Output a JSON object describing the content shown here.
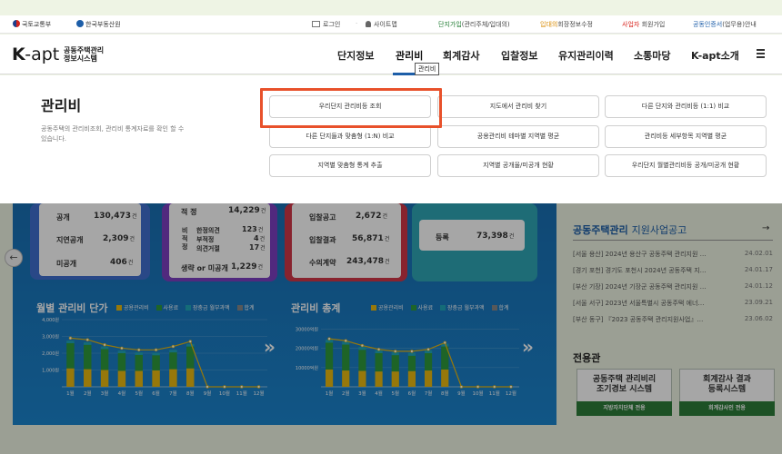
{
  "util": {
    "gov": "국토교통부",
    "reb": "한국부동산원",
    "login": "로그인",
    "sitemap": "사이트맵",
    "join_main": "단지가입",
    "join_sub": "(관리주체/입대의)",
    "resident_main": "입대의",
    "resident_sub": "회장정보수정",
    "biz_main": "사업자",
    "biz_sub": "회원가입",
    "cert_main": "공동인증서",
    "cert_sub": "(업무용)안내"
  },
  "logo": {
    "k": "K",
    "apt": "-apt",
    "line1": "공동주택관리",
    "line2": "정보시스템"
  },
  "menu": [
    "단지정보",
    "관리비",
    "회계감사",
    "입찰정보",
    "유지관리이력",
    "소통마당",
    "K-apt소개"
  ],
  "tooltip": "관리비",
  "panel": {
    "title": "관리비",
    "desc": "공동주택의 관리비조회, 관리비 통계자료를 확인 할 수 있습니다.",
    "buttons": [
      "우리단지 관리비등 조회",
      "지도에서 관리비 찾기",
      "다른 단지와 관리비등 (1:1) 비교",
      "다른 단지들과 맞춤형 (1:N) 비교",
      "공용관리비 테마별 지역별 평균",
      "관리비등 세부항목 지역별 평균",
      "지역별 맞춤형 통계 추출",
      "지역별 공개율/미공개 현황",
      "우리단지 월별관리비등 공개/미공개 현황"
    ]
  },
  "stats": {
    "c1": [
      {
        "label": "공개",
        "value": "130,473",
        "unit": "건"
      },
      {
        "label": "지연공개",
        "value": "2,309",
        "unit": "건"
      },
      {
        "label": "미공개",
        "value": "406",
        "unit": "건"
      }
    ],
    "c2": {
      "top_label": "적 정",
      "top_value": "14,229",
      "top_unit": "건",
      "side": "비\n적\n정",
      "rows": [
        {
          "label": "한정의견",
          "value": "123",
          "unit": "건"
        },
        {
          "label": "부적정",
          "value": "4",
          "unit": "건"
        },
        {
          "label": "의견거절",
          "value": "17",
          "unit": "건"
        }
      ],
      "bottom_label": "생략 or 미공개",
      "bottom_value": "1,229",
      "bottom_unit": "건"
    },
    "c3": [
      {
        "label": "입찰공고",
        "value": "2,672",
        "unit": "건"
      },
      {
        "label": "입찰결과",
        "value": "56,871",
        "unit": "건"
      },
      {
        "label": "수의계약",
        "value": "243,478",
        "unit": "건"
      }
    ],
    "c4": {
      "label": "등록",
      "value": "73,398",
      "unit": "건"
    }
  },
  "charts": {
    "monthly_title": "월별 관리비 단가",
    "total_title": "관리비 총계",
    "legend": [
      "공용관리비",
      "사용료",
      "장충금 월부과액",
      "합계"
    ],
    "legend_colors": [
      "#e8b810",
      "#2f9a3c",
      "#1fa7b8",
      "#888888"
    ],
    "monthly_yticks": [
      "4,000원",
      "3,000원",
      "2,000원",
      "1,000원"
    ],
    "total_yticks": [
      "30000억원",
      "20000억원",
      "10000억원"
    ],
    "months": [
      "1월",
      "2월",
      "3월",
      "4월",
      "5월",
      "6월",
      "7월",
      "8월",
      "9월",
      "10월",
      "11월",
      "12월"
    ]
  },
  "chart_data": [
    {
      "type": "bar",
      "title": "월별 관리비 단가",
      "categories": [
        "1월",
        "2월",
        "3월",
        "4월",
        "5월",
        "6월",
        "7월",
        "8월",
        "9월",
        "10월",
        "11월",
        "12월"
      ],
      "ylim": [
        0,
        4000
      ],
      "series": [
        {
          "name": "공용관리비",
          "values": [
            1100,
            1050,
            1000,
            950,
            950,
            980,
            1050,
            1100,
            0,
            0,
            0,
            0
          ]
        },
        {
          "name": "사용료",
          "values": [
            1500,
            1450,
            1250,
            1050,
            950,
            900,
            1000,
            1300,
            0,
            0,
            0,
            0
          ]
        },
        {
          "name": "장충금 월부과액",
          "values": [
            150,
            150,
            150,
            150,
            150,
            150,
            150,
            150,
            0,
            0,
            0,
            0
          ]
        },
        {
          "name": "합계",
          "values": [
            2900,
            2800,
            2500,
            2300,
            2200,
            2200,
            2400,
            2700,
            0,
            0,
            0,
            0
          ]
        }
      ]
    },
    {
      "type": "bar",
      "title": "관리비 총계",
      "categories": [
        "1월",
        "2월",
        "3월",
        "4월",
        "5월",
        "6월",
        "7월",
        "8월",
        "9월",
        "10월",
        "11월",
        "12월"
      ],
      "ylim": [
        0,
        35000
      ],
      "series": [
        {
          "name": "공용관리비",
          "values": [
            9000,
            8500,
            8300,
            8000,
            8000,
            8200,
            8500,
            9000,
            0,
            0,
            0,
            0
          ]
        },
        {
          "name": "사용료",
          "values": [
            14000,
            13500,
            11000,
            9500,
            8500,
            8000,
            9000,
            12000,
            0,
            0,
            0,
            0
          ]
        },
        {
          "name": "장충금 월부과액",
          "values": [
            1500,
            1500,
            1500,
            1500,
            1500,
            1500,
            1500,
            1500,
            0,
            0,
            0,
            0
          ]
        },
        {
          "name": "합계",
          "values": [
            25000,
            24000,
            21500,
            19500,
            18500,
            18500,
            19500,
            23000,
            0,
            0,
            0,
            0
          ]
        }
      ]
    }
  ],
  "side": {
    "notice_title": "공동주택관리",
    "notice_title2": "지원사업공고",
    "news": [
      {
        "t": "[서울 용산] 2024년 용산구 공동주택 관리지원 …",
        "d": "24.02.01"
      },
      {
        "t": "[경기 포천] 경기도 포천시 2024년 공동주택 지…",
        "d": "24.01.17"
      },
      {
        "t": "[부산 기장] 2024년 기장군 공동주택 관리지원 …",
        "d": "24.01.12"
      },
      {
        "t": "[서울 서구] 2023년 서울특별시 공동주택 에너…",
        "d": "23.09.21"
      },
      {
        "t": "[부산 동구] 『2023 공동주택 관리지원사업』…",
        "d": "23.06.02"
      }
    ],
    "special_title": "전용관",
    "sys1": "공동주택 관리비리\n조기경보 시스템",
    "sys1_tag": "지방자치단체 전용",
    "sys2": "회계감사 결과\n등록시스템",
    "sys2_tag": "회계감사인 전용"
  }
}
